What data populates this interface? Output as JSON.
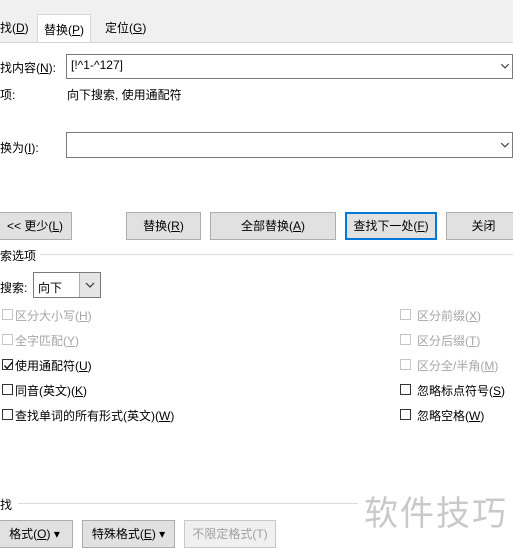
{
  "tabs": [
    {
      "label": "查找(D)",
      "text": "找(",
      "key": "D",
      "end": ")"
    },
    {
      "label": "替换(P)",
      "text": "替换(",
      "key": "P",
      "end": ")"
    },
    {
      "label": "定位(G)",
      "text": "定位(",
      "key": "G",
      "end": ")"
    }
  ],
  "find": {
    "label_text": "找内容(",
    "label_key": "N",
    "label_end": "):",
    "value": "[!^1-^127]",
    "options_label": "项:",
    "options_value": "向下搜索, 使用通配符"
  },
  "replace": {
    "label_text": "换为(",
    "label_key": "I",
    "label_end": "):",
    "value": ""
  },
  "buttons": {
    "less": {
      "text": "<< 更少(",
      "key": "L",
      "end": ")"
    },
    "replace": {
      "text": "替换(",
      "key": "R",
      "end": ")"
    },
    "replace_all": {
      "text": "全部替换(",
      "key": "A",
      "end": ")"
    },
    "find_next": {
      "text": "查找下一处(",
      "key": "F",
      "end": ")"
    },
    "close": "关闭"
  },
  "search_options": {
    "heading": "索选项",
    "search_label_text": "搜索",
    "search_label_end": ":",
    "direction": "向下"
  },
  "options_left": [
    {
      "text": "区分大小写(",
      "key": "H",
      "end": ")",
      "checked": false,
      "disabled": true
    },
    {
      "text": "全字匹配(",
      "key": "Y",
      "end": ")",
      "checked": false,
      "disabled": true
    },
    {
      "text": "使用通配符(",
      "key": "U",
      "end": ")",
      "checked": true,
      "disabled": false
    },
    {
      "text": "同音(英文)(",
      "key": "K",
      "end": ")",
      "checked": false,
      "disabled": false
    },
    {
      "text": "查找单词的所有形式(英文)(",
      "key": "W",
      "end": ")",
      "checked": false,
      "disabled": false
    }
  ],
  "options_right": [
    {
      "text": "区分前缀(",
      "key": "X",
      "end": ")",
      "checked": false,
      "disabled": true
    },
    {
      "text": "区分后缀(",
      "key": "T",
      "end": ")",
      "checked": false,
      "disabled": true
    },
    {
      "text": "区分全/半角(",
      "key": "M",
      "end": ")",
      "checked": false,
      "disabled": true
    },
    {
      "text": "忽略标点符号(",
      "key": "S",
      "end": ")",
      "checked": false,
      "disabled": false
    },
    {
      "text": "忽略空格(",
      "key": "W",
      "end": ")",
      "checked": false,
      "disabled": false
    }
  ],
  "find_section": {
    "heading": "找",
    "format": {
      "text": "格式(",
      "key": "O",
      "end": ") ▾"
    },
    "special": {
      "text": "特殊格式(",
      "key": "E",
      "end": ") ▾"
    },
    "no_format": "不限定格式(T)"
  },
  "watermark": "软件技巧"
}
